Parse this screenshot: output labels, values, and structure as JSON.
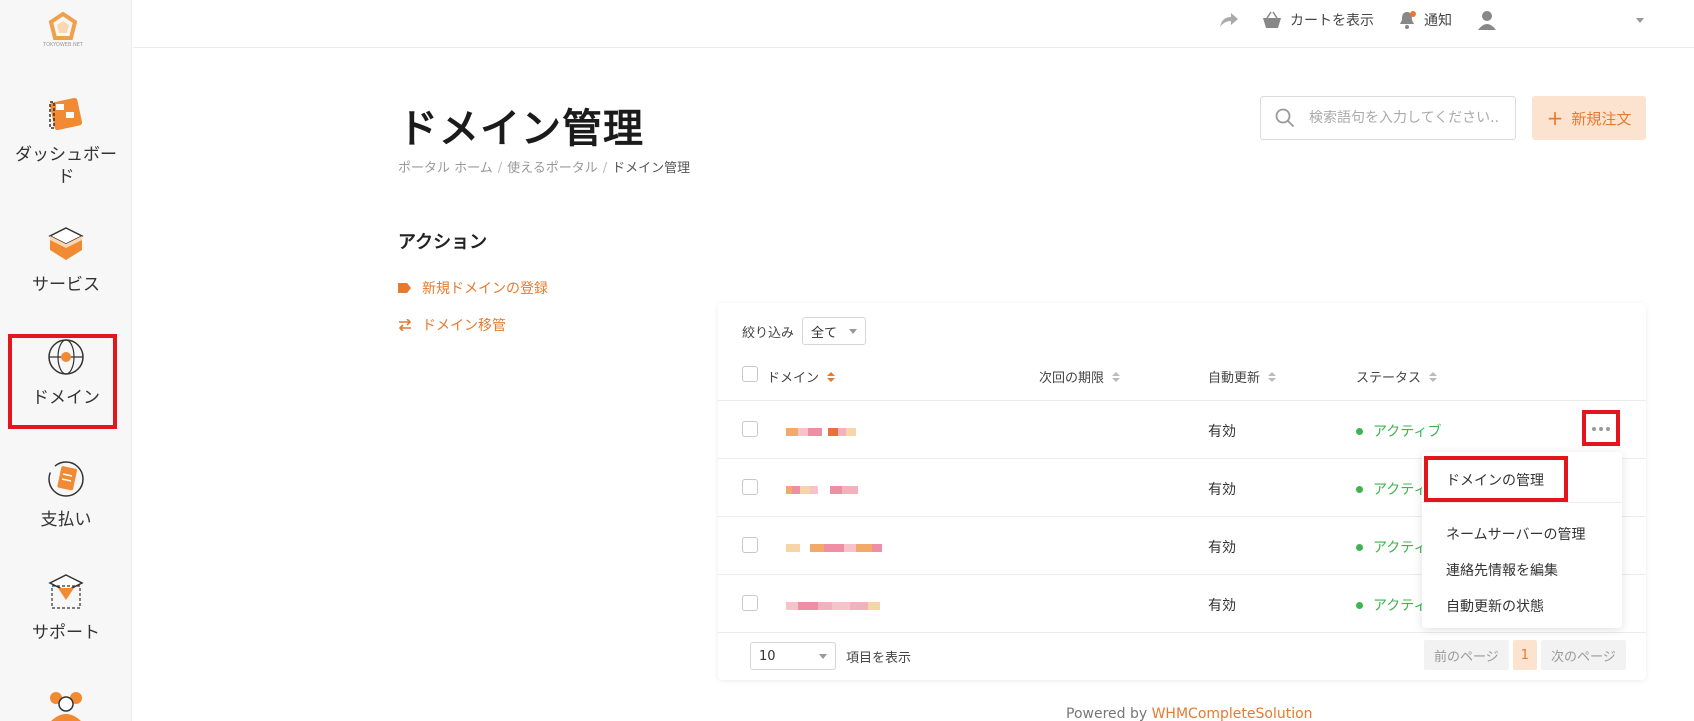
{
  "brand": {
    "accent": "#e67a2e",
    "highlight": "#e3161d",
    "active": "#3fb34f"
  },
  "logo": {
    "text": "TOKYOWEB.NET"
  },
  "sidebar": {
    "items": [
      {
        "label": "ダッシュボード",
        "icon": "dashboard-icon"
      },
      {
        "label": "サービス",
        "icon": "box-icon"
      },
      {
        "label": "ドメイン",
        "icon": "globe-icon"
      },
      {
        "label": "支払い",
        "icon": "billing-icon"
      },
      {
        "label": "サポート",
        "icon": "support-icon"
      }
    ]
  },
  "topbar": {
    "cart": "カートを表示",
    "notifications": "通知"
  },
  "page": {
    "title": "ドメイン管理",
    "breadcrumb": [
      "ポータル ホーム",
      "使えるポータル",
      "ドメイン管理"
    ]
  },
  "search": {
    "placeholder": "検索語句を入力してください..."
  },
  "new_order": {
    "label": "新規注文"
  },
  "actions": {
    "title": "アクション",
    "items": [
      "新規ドメインの登録",
      "ドメイン移管"
    ]
  },
  "table": {
    "filter_label": "絞り込み",
    "filter_value": "全て",
    "columns": [
      "ドメイン",
      "次回の期限",
      "自動更新",
      "ステータス"
    ],
    "rows": [
      {
        "auto_renew": "有効",
        "status": "アクティブ"
      },
      {
        "auto_renew": "有効",
        "status": "アクティブ"
      },
      {
        "auto_renew": "有効",
        "status": "アクティブ"
      },
      {
        "auto_renew": "有効",
        "status": "アクティブ"
      }
    ],
    "per_page_value": "10",
    "per_page_label": "項目を表示",
    "pager": {
      "prev": "前のページ",
      "current": "1",
      "next": "次のページ"
    }
  },
  "row_menu": {
    "items": [
      "ドメインの管理",
      "ネームサーバーの管理",
      "連絡先情報を編集",
      "自動更新の状態"
    ]
  },
  "footer": {
    "prefix": "Powered by ",
    "link": "WHMCompleteSolution"
  }
}
